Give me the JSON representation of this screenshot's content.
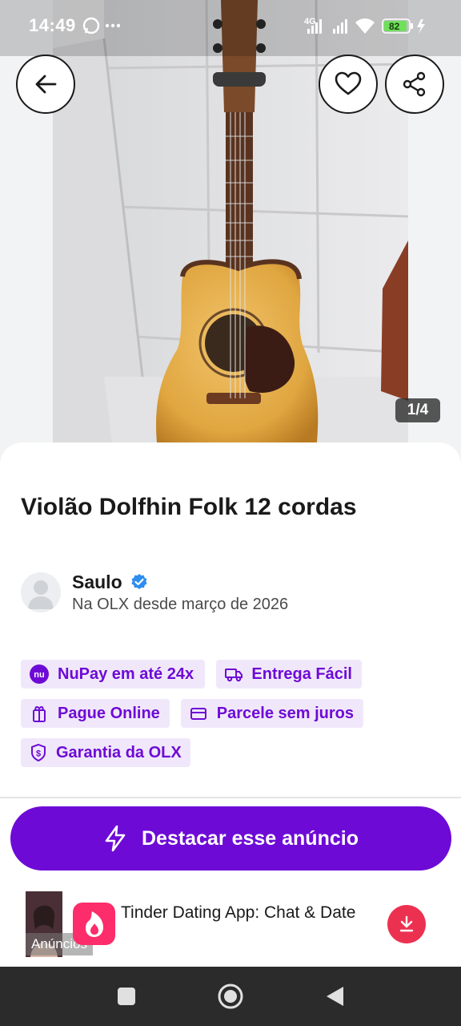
{
  "status_bar": {
    "time": "14:49",
    "network": "4G",
    "battery": "82"
  },
  "photo": {
    "counter": "1/4"
  },
  "listing": {
    "title": "Violão Dolfhin Folk 12 cordas"
  },
  "seller": {
    "name": "Saulo",
    "since": "Na OLX desde março de 2026"
  },
  "badges": [
    {
      "label": "NuPay em até 24x",
      "icon": "nupay-icon"
    },
    {
      "label": "Entrega Fácil",
      "icon": "delivery-icon"
    },
    {
      "label": "Pague Online",
      "icon": "gift-icon"
    },
    {
      "label": "Parcele sem juros",
      "icon": "card-icon"
    },
    {
      "label": "Garantia da OLX",
      "icon": "shield-dollar-icon"
    }
  ],
  "cta": {
    "label": "Destacar esse anúncio"
  },
  "ad": {
    "badge": "Anúncios",
    "text": "Tinder Dating App: Chat & Date"
  },
  "colors": {
    "brand": "#6e0ad6",
    "chip_bg": "#f0e8fa",
    "tinder": "#fd2c6a",
    "download": "#ec3150"
  }
}
